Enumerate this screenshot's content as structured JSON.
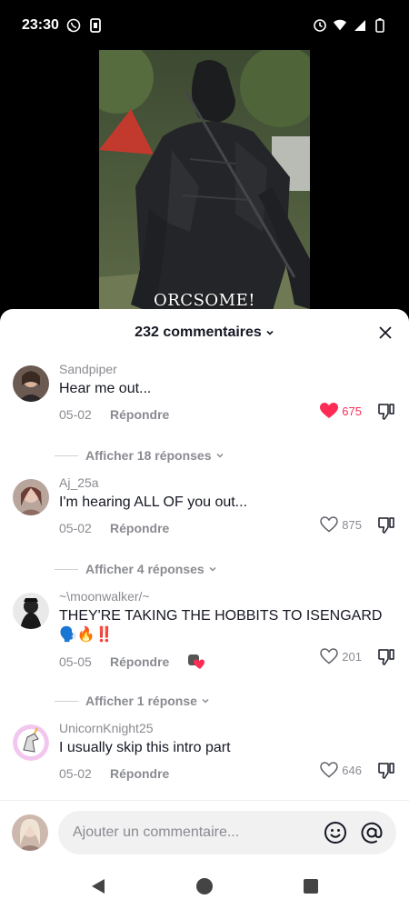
{
  "status_bar": {
    "time": "23:30",
    "icons": [
      "whatsapp-icon",
      "sim-icon",
      "alarm-icon",
      "wifi-icon",
      "signal-icon",
      "battery-icon"
    ]
  },
  "video": {
    "caption": "ORCSOME!"
  },
  "comments_sheet": {
    "title": "232 commentaires",
    "close_icon": "close-icon",
    "accent_color": "#fe2c55",
    "comments": [
      {
        "username": "Sandpiper",
        "text": "Hear me out...",
        "date": "05-02",
        "reply_label": "Répondre",
        "likes": "675",
        "liked": true,
        "replies_label": "Afficher 18 réponses"
      },
      {
        "username": "Aj_25a",
        "text": "I'm hearing ALL OF you out...",
        "date": "05-02",
        "reply_label": "Répondre",
        "likes": "875",
        "liked": false,
        "replies_label": "Afficher 4 réponses"
      },
      {
        "username": "~\\moonwalker/~",
        "text": "THEY'RE TAKING THE HOBBITS TO ISENGARD 🗣️🔥‼️",
        "date": "05-05",
        "reply_label": "Répondre",
        "likes": "201",
        "liked": false,
        "replies_label": "Afficher 1 réponse"
      },
      {
        "username": "UnicornKnight25",
        "text": "I usually skip this intro part",
        "date": "05-02",
        "reply_label": "Répondre",
        "likes": "646",
        "liked": false
      }
    ]
  },
  "comment_input": {
    "placeholder": "Ajouter un commentaire..."
  },
  "nav": {
    "icons": [
      "back-icon",
      "home-icon",
      "recents-icon"
    ]
  }
}
